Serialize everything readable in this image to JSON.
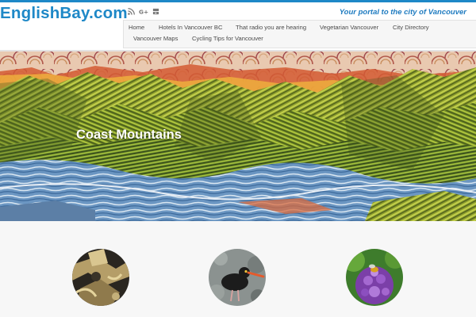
{
  "header": {
    "logo_text": "EnglishBay.com",
    "tagline": "Your portal to the city of Vancouver",
    "social_icons": [
      "rss-icon",
      "google-plus-icon",
      "youtube-icon"
    ]
  },
  "nav": {
    "items": [
      {
        "label": "Home"
      },
      {
        "label": "Hotels In Vancouver BC"
      },
      {
        "label": "That radio you are hearing"
      },
      {
        "label": "Vegetarian Vancouver"
      },
      {
        "label": "City Directory"
      },
      {
        "label": "Vancouver Maps"
      },
      {
        "label": "Cycling Tips for Vancouver"
      }
    ]
  },
  "hero": {
    "title": "Coast Mountains"
  },
  "features": {
    "items": [
      {
        "image": "metal-sculpture-thumbnail"
      },
      {
        "image": "oystercatcher-bird-thumbnail"
      },
      {
        "image": "purple-allium-flower-with-bee-thumbnail"
      }
    ]
  },
  "colors": {
    "brand_blue": "#1e88c7",
    "tagline_blue": "#1e7bc0",
    "nav_background": "#f6f6f6",
    "nav_text": "#4a4a4a",
    "features_background": "#f7f7f7"
  }
}
